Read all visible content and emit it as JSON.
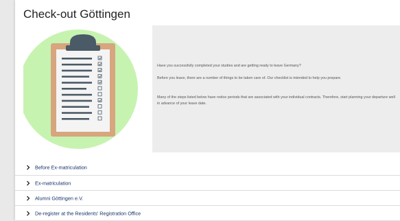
{
  "page": {
    "title": "Check-out Göttingen"
  },
  "illustration": {
    "icon": "clipboard-checklist-icon",
    "colors": {
      "circle": "#c7f3b0",
      "board": "#d7a57e",
      "paper": "#f4f4f4",
      "clip": "#4a5a66",
      "lines": "#4a5a66"
    }
  },
  "intro": {
    "paragraphs": [
      "Have you successfully completed your studies and are getting ready to leave Germany?",
      "Before you leave, there are a number of things to be taken care of. Our checklist is intended to help you prepare.",
      "Many of the steps listed below have notice periods that are associated with your individual contracts. Therefore, start planning your departure well in advance of your leave date."
    ]
  },
  "accordion": {
    "items": [
      {
        "label": "Before Ex-matriculation"
      },
      {
        "label": "Ex-matriculation"
      },
      {
        "label": "Alumni Göttingen e.V."
      },
      {
        "label": "De-register at the Residents' Registration Office"
      }
    ]
  },
  "colors": {
    "link": "#153268",
    "intro_background": "#ededed",
    "divider": "#dcdcdc"
  }
}
